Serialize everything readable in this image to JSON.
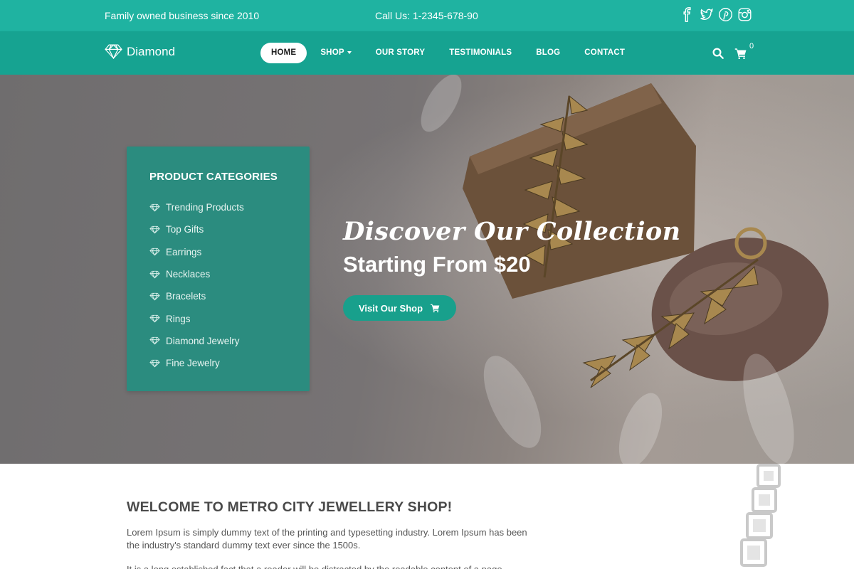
{
  "topbar": {
    "tagline": "Family owned business since 2010",
    "phone": "Call Us: 1-2345-678-90",
    "socials": [
      "facebook-icon",
      "twitter-icon",
      "pinterest-icon",
      "instagram-icon"
    ]
  },
  "header": {
    "brand": "Diamond",
    "nav": [
      {
        "label": "HOME",
        "active": true
      },
      {
        "label": "SHOP",
        "dropdown": true
      },
      {
        "label": "OUR STORY"
      },
      {
        "label": "TESTIMONIALS"
      },
      {
        "label": "BLOG"
      },
      {
        "label": "CONTACT"
      }
    ],
    "cart_count": "0"
  },
  "hero": {
    "script_title": "Discover Our Collection",
    "subtitle": "Starting From $20",
    "button_label": "Visit Our Shop"
  },
  "categories": {
    "title": "PRODUCT CATEGORIES",
    "items": [
      "Trending Products",
      "Top Gifts",
      "Earrings",
      "Necklaces",
      "Bracelets",
      "Rings",
      "Diamond Jewelry",
      "Fine Jewelry"
    ]
  },
  "welcome": {
    "title": "WELCOME TO METRO CITY JEWELLERY SHOP!",
    "para1": "Lorem Ipsum is simply dummy text of the printing and typesetting industry. Lorem Ipsum has been the industry's standard dummy text ever since the 1500s.",
    "para2": "It is a long established fact that a reader will be distracted by the readable content of a page"
  },
  "colors": {
    "accent": "#1fb3a1",
    "nav": "#16a391",
    "category_panel": "#2b8c7f",
    "button": "#18a08c"
  }
}
